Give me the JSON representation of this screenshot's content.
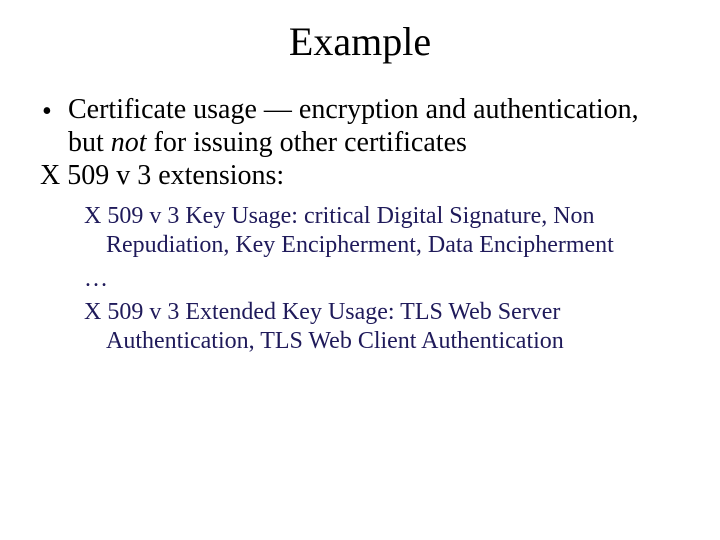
{
  "title": "Example",
  "bullet": {
    "mark": "•",
    "pre": "Certificate usage — encryption and authentication, but ",
    "em": "not",
    "post": " for issuing other certificates"
  },
  "ext_label": "X 509 v 3 extensions:",
  "sub": {
    "key_usage": "X 509 v 3 Key Usage: critical Digital Signature, Non Repudiation, Key Encipherment, Data Encipherment",
    "ellipsis": "…",
    "ext_key_usage": "X 509 v 3 Extended Key Usage: TLS Web Server Authentication, TLS Web Client Authentication"
  }
}
